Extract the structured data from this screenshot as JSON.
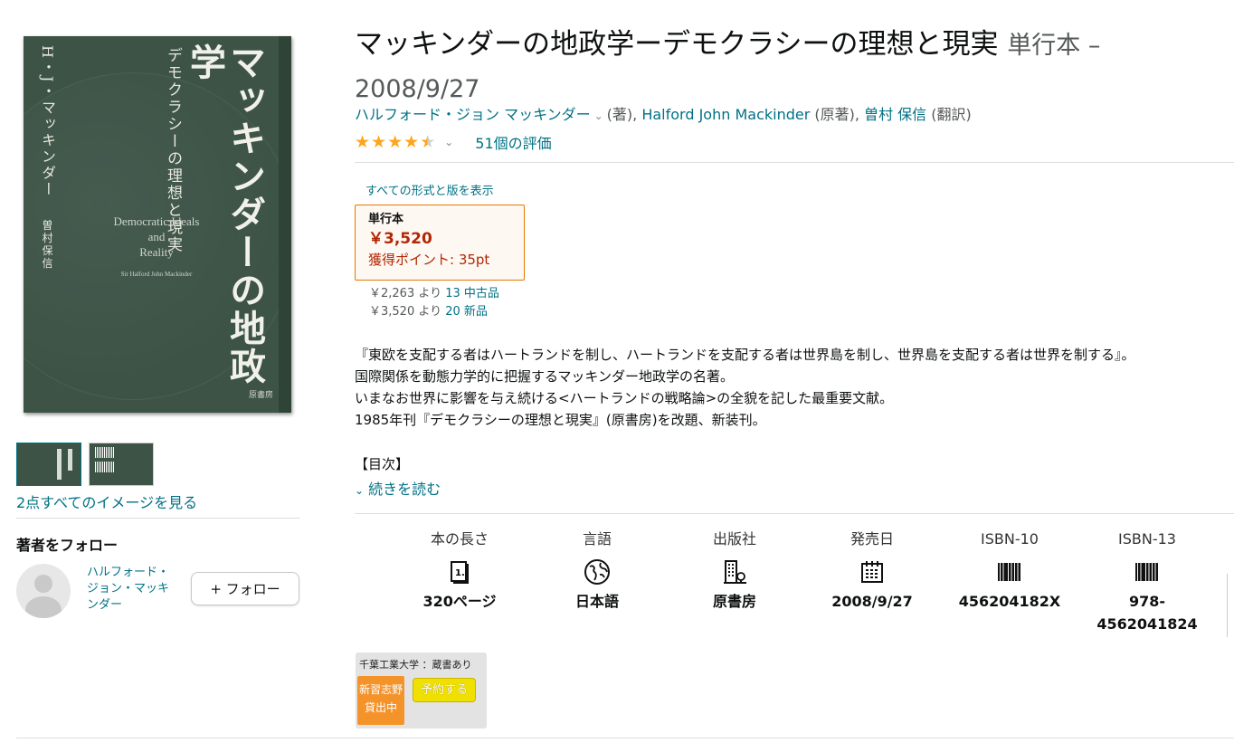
{
  "cover": {
    "title": "マッキンダーの地政学",
    "subtitle": "デモクラシーの理想と現実",
    "author": "H・J・マッキンダー",
    "translator": "曽村保信",
    "en_title_lines": [
      "Democratic Ideals",
      "and",
      "Reality"
    ],
    "en_author": "Sir Halford John Mackinder",
    "publisher": "原書房"
  },
  "gallery": {
    "see_all_label": "2点すべてのイメージを見る"
  },
  "follow": {
    "heading": "著者をフォロー",
    "author_name": "ハルフォード・ジョン・マッキンダー",
    "button_label": "+ フォロー"
  },
  "product": {
    "title": "マッキンダーの地政学ーデモクラシーの理想と現実",
    "format": "単行本 –",
    "date": "2008/9/27",
    "contributors": [
      {
        "name": "ハルフォード・ジョン マッキンダー",
        "role": "(著),",
        "has_menu": true
      },
      {
        "name": "Halford John Mackinder",
        "role": "(原著),",
        "has_menu": false
      },
      {
        "name": "曽村 保信",
        "role": "(翻訳)",
        "has_menu": false
      }
    ],
    "rating_stars": 4.5,
    "rating_count_label": "51個の評価"
  },
  "formats": {
    "all_formats_label": "すべての形式と版を表示",
    "selected": {
      "name": "単行本",
      "price": "￥3,520",
      "points": "獲得ポイント: 35pt"
    },
    "offers": [
      {
        "price_prefix": "￥2,263 より",
        "link": "13 中古品"
      },
      {
        "price_prefix": "￥3,520 より",
        "link": "20 新品"
      }
    ]
  },
  "description": {
    "lines": [
      "『東欧を支配する者はハートランドを制し、ハートランドを支配する者は世界島を制し、世界島を支配する者は世界を制する』。",
      "国際関係を動態力学的に把握するマッキンダー地政学の名著。",
      "いまなお世界に影響を与え続ける<ハートランドの戦略論>の全貌を記した最重要文献。",
      "1985年刊『デモクラシーの理想と現実』(原書房)を改題、新装刊。"
    ],
    "toc_label": "【目次】",
    "read_more_label": "続きを読む"
  },
  "details": [
    {
      "label": "本の長さ",
      "icon": "book-pages-icon",
      "value": "320ページ"
    },
    {
      "label": "言語",
      "icon": "globe-icon",
      "value": "日本語"
    },
    {
      "label": "出版社",
      "icon": "building-icon",
      "value": "原書房"
    },
    {
      "label": "発売日",
      "icon": "calendar-icon",
      "value": "2008/9/27"
    },
    {
      "label": "ISBN-10",
      "icon": "barcode-icon",
      "value": "456204182X"
    },
    {
      "label": "ISBN-13",
      "icon": "barcode-icon",
      "value": "978-4562041824"
    }
  ],
  "library": {
    "name": "千葉工業大学 ：蔵書あり",
    "branch": "新習志野",
    "status": "貸出中",
    "reserve_label": "予約する"
  },
  "colors": {
    "link": "#007185",
    "price": "#b12704",
    "star": "#ffa41c",
    "selected_border": "#e77600"
  }
}
